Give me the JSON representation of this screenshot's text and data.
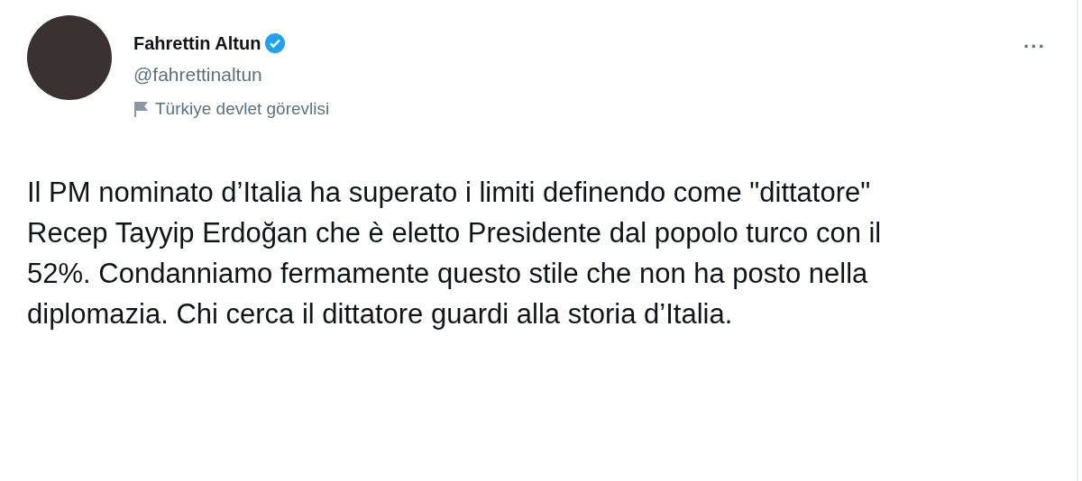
{
  "author": {
    "name": "Fahrettin Altun",
    "verified": true,
    "handle": "@fahrettinaltun",
    "label": "Türkiye devlet görevlisi"
  },
  "more_menu": "···",
  "tweet_text": "Il PM nominato d’Italia ha superato i limiti definendo come \"dittatore\" Recep Tayyip Erdoğan che è eletto Presidente dal popolo turco con il 52%. Condanniamo fermamente questo stile che non ha posto nella diplomazia. Chi cerca il dittatore guardi alla storia d’Italia."
}
